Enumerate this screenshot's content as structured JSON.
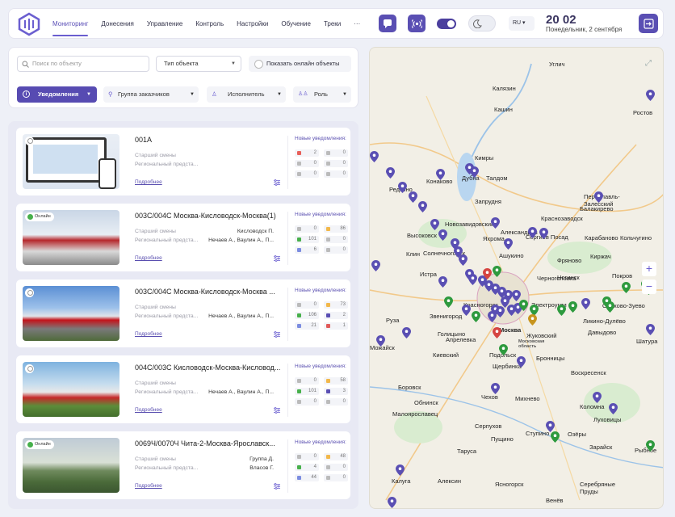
{
  "nav": [
    "Мониторинг",
    "Донесения",
    "Управление",
    "Контроль",
    "Настройки",
    "Обучение",
    "Треки",
    "···"
  ],
  "header": {
    "time": "20 02",
    "date": "Понедельник, 2 сентября",
    "lang": "RU ▾"
  },
  "filters": {
    "search_placeholder": "Поиск по объекту",
    "object_type": "Тип объекта",
    "online_label": "Показать онлайн объекты",
    "notifications": "Уведомления",
    "customer_group": "Группа заказчиков",
    "executor": "Исполнитель",
    "role": "Роль"
  },
  "cards": [
    {
      "title": "001А",
      "online": false,
      "role": "Старший смены",
      "region": "Региональный предста...",
      "right1": "",
      "right2": "",
      "more": "Подробнее",
      "nhead": "Новые уведомления:",
      "stats": [
        "2",
        "0",
        "0",
        "0",
        "0",
        "0"
      ]
    },
    {
      "title": "003С/004С Москва-Кисловодск-Москва(1)",
      "online": true,
      "online_label": "Онлайн",
      "role": "Старший смены",
      "region": "Региональный предста...",
      "right1": "Кисловодск П.",
      "right2": "Нечаев А., Ваулин А., П...",
      "more": "Подробнее",
      "nhead": "Новые уведомления:",
      "stats": [
        "0",
        "86",
        "101",
        "0",
        "6",
        "0"
      ]
    },
    {
      "title": "003С/004С Москва-Кисловодск-Москва ...",
      "online": false,
      "role": "Старший смены",
      "region": "Региональный предста...",
      "right1": "",
      "right2": "Нечаев А., Ваулин А., П...",
      "more": "Подробнее",
      "nhead": "Новые уведомления:",
      "stats": [
        "0",
        "73",
        "106",
        "2",
        "21",
        "1"
      ]
    },
    {
      "title": "004С/003С Кисловодск-Москва-Кисловод...",
      "online": false,
      "role": "Старший смены",
      "region": "Региональный предста...",
      "right1": "",
      "right2": "Нечаев А., Ваулин А., П...",
      "more": "Подробнее",
      "nhead": "Новые уведомления:",
      "stats": [
        "0",
        "58",
        "101",
        "3",
        "0",
        "0"
      ]
    },
    {
      "title": "0069Ч/0070Ч Чита-2-Москва-Ярославск...",
      "online": true,
      "online_label": "Онлайн",
      "role": "Старший смены",
      "region": "Региональный предста...",
      "right1": "Группа Д.",
      "right2": "Власов Г.",
      "more": "Подробнее",
      "nhead": "Новые уведомления:",
      "stats": [
        "0",
        "48",
        "4",
        "0",
        "44",
        "0"
      ]
    }
  ],
  "map_labels": [
    "Углич",
    "Калязин",
    "Кашин",
    "Ростов",
    "Кимры",
    "Талдом",
    "Дубна",
    "Конаково",
    "Переславль-Залесский",
    "Запрудня",
    "Редкино",
    "Балакирево",
    "Александров",
    "Новозавидовский",
    "Высоковск",
    "Краснозаводск",
    "Сергиев Посад",
    "Кольчугино",
    "Клин",
    "Яхрома",
    "Карабаново",
    "Солнечногорск",
    "Ашукино",
    "Киржач",
    "Истра",
    "Фряново",
    "Черноголовка",
    "Ногинск",
    "Покров",
    "Звенигород",
    "Красногорск",
    "Орехово-Зуево",
    "Можайск",
    "Руза",
    "Голицыно",
    "Москва",
    "Электроугли",
    "Ликино-Дулёво",
    "Киевский",
    "Апрелевка",
    "Жуковский",
    "Давыдово",
    "Шатура",
    "Бронницы",
    "Подольск",
    "Московская область",
    "Щербинка",
    "Воскресенск",
    "Боровск",
    "Обнинск",
    "Чехов",
    "Михнево",
    "Коломна",
    "Луховицы",
    "Малоярославец",
    "Серпухов",
    "Ступино",
    "Озёры",
    "Зарайск",
    "Таруса",
    "Пущино",
    "Рыбное",
    "Калуга",
    "Алексин",
    "Ясногорск",
    "Серебряные Пруды",
    "Венёв"
  ],
  "colors": {
    "accent": "#574bb2",
    "pin_purple": "#5a4fb3",
    "pin_green": "#2e9a3e",
    "pin_red": "#d64541",
    "pin_gold": "#c8951e"
  }
}
